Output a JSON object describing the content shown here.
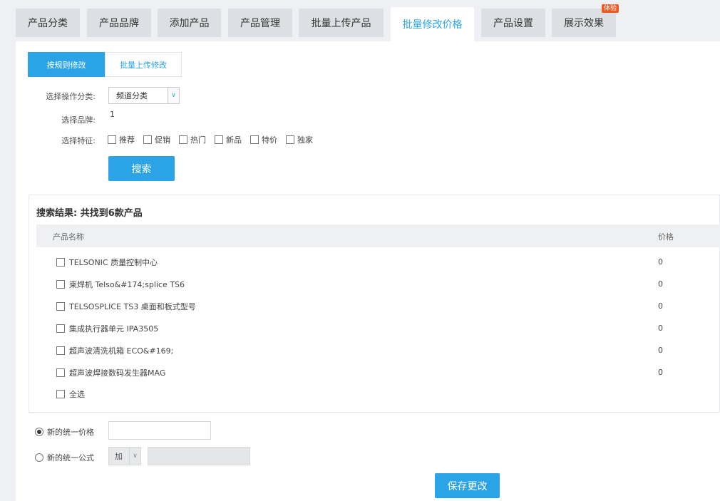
{
  "tabs": [
    {
      "label": "产品分类"
    },
    {
      "label": "产品品牌"
    },
    {
      "label": "添加产品"
    },
    {
      "label": "产品管理"
    },
    {
      "label": "批量上传产品"
    },
    {
      "label": "批量修改价格"
    },
    {
      "label": "产品设置"
    },
    {
      "label": "展示效果",
      "badge": "体验"
    }
  ],
  "active_tab_index": 5,
  "subtabs": [
    {
      "label": "按规则修改"
    },
    {
      "label": "批量上传修改"
    }
  ],
  "form": {
    "category_label": "选择操作分类:",
    "category_value": "频道分类",
    "brand_label": "选择品牌:",
    "brand_value": "1",
    "features_label": "选择特征:",
    "features": [
      {
        "label": "推荐"
      },
      {
        "label": "促销"
      },
      {
        "label": "热门"
      },
      {
        "label": "新品"
      },
      {
        "label": "特价"
      },
      {
        "label": "独家"
      }
    ],
    "search_button": "搜索"
  },
  "results": {
    "title": "搜索结果: 共找到6款产品",
    "col_name": "产品名称",
    "col_price": "价格",
    "rows": [
      {
        "name": "TELSONIC 质量控制中心",
        "price": "0"
      },
      {
        "name": "柬焊机 Telso&#174;splice TS6",
        "price": "0"
      },
      {
        "name": "TELSOSPLICE TS3 桌面和板式型号",
        "price": "0"
      },
      {
        "name": "集成执行器单元 IPA3505",
        "price": "0"
      },
      {
        "name": "超声波清洗机箱 ECO&#169;",
        "price": "0"
      },
      {
        "name": "超声波焊接数码发生器MAG",
        "price": "0"
      }
    ],
    "select_all": "全选"
  },
  "bottom": {
    "unified_price_label": "新的统一价格",
    "unified_formula_label": "新的统一公式",
    "formula_operator": "加",
    "save_button": "保存更改"
  },
  "colors": {
    "accent": "#2aa4e6",
    "badge": "#f05a22"
  }
}
